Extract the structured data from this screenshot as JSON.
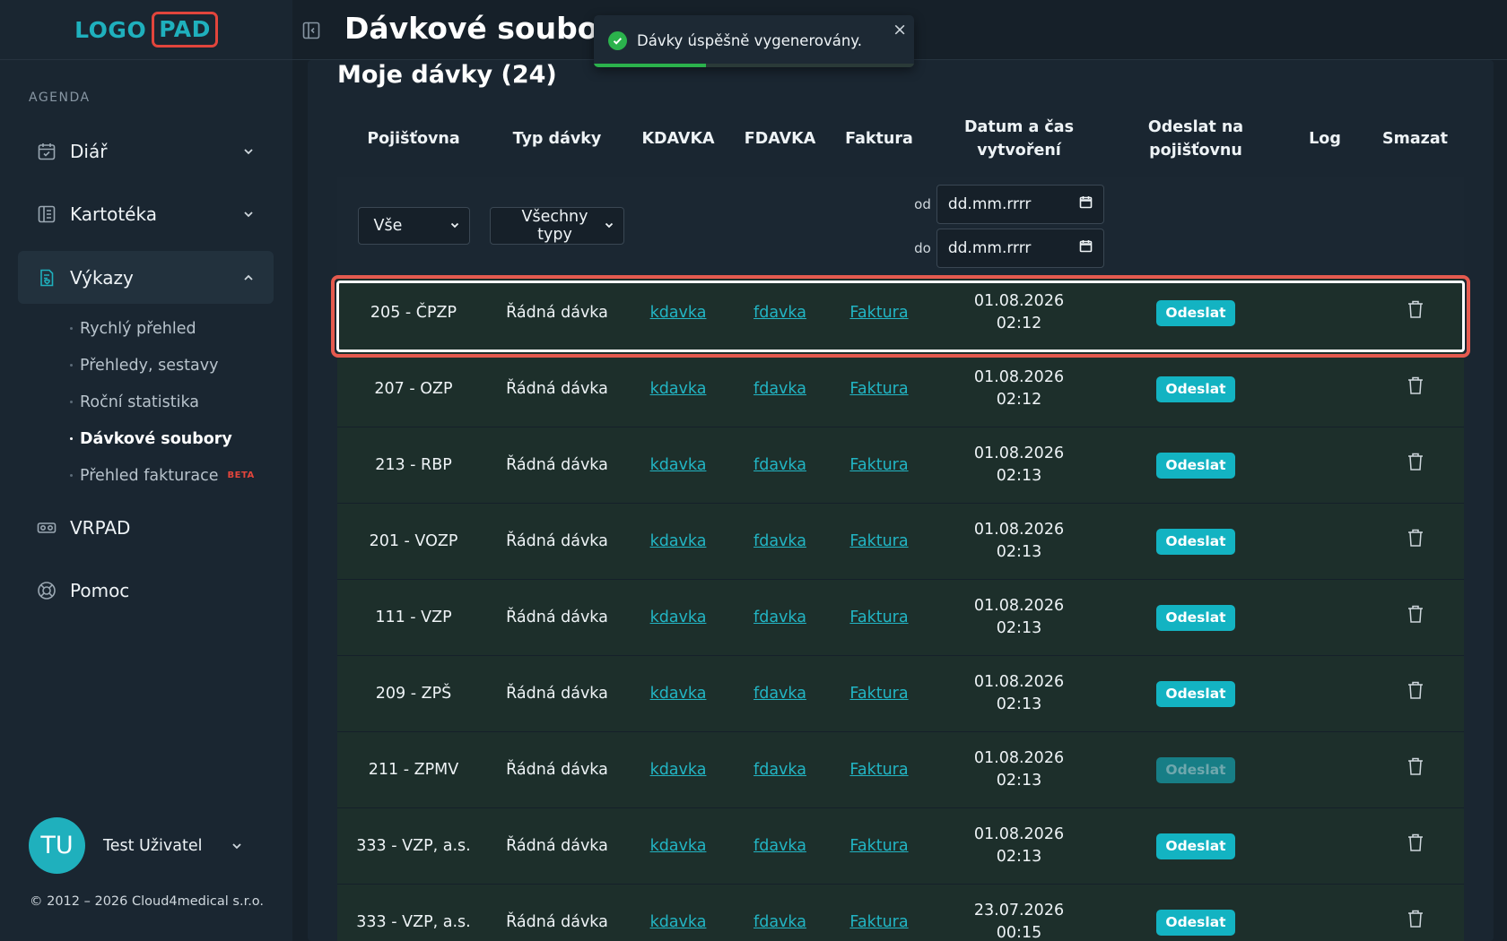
{
  "app": {
    "logo_left": "LOGO",
    "logo_right": "PAD",
    "page_title": "Dávkové soubory"
  },
  "sidebar": {
    "section_label": "AGENDA",
    "items": [
      {
        "label": "Diář",
        "icon": "calendar-icon"
      },
      {
        "label": "Kartotéka",
        "icon": "card-index-icon"
      },
      {
        "label": "Výkazy",
        "icon": "report-icon",
        "expanded": true
      },
      {
        "label": "VRPAD",
        "icon": "vr-glasses-icon"
      },
      {
        "label": "Pomoc",
        "icon": "lifebuoy-icon"
      }
    ],
    "sub_items": [
      {
        "label": "Rychlý přehled"
      },
      {
        "label": "Přehledy, sestavy"
      },
      {
        "label": "Roční statistika"
      },
      {
        "label": "Dávkové soubory",
        "active": true
      },
      {
        "label": "Přehled fakturace",
        "badge": "BETA"
      }
    ],
    "user": {
      "initials": "TU",
      "name": "Test Uživatel"
    },
    "copyright": "© 2012 – 2026 Cloud4medical s.r.o."
  },
  "toast": {
    "message": "Dávky úspěšně vygenerovány.",
    "close": "×",
    "progress": 0.35
  },
  "main": {
    "section_title": "Moje dávky (24)",
    "columns": [
      "Pojišťovna",
      "Typ dávky",
      "KDAVKA",
      "FDAVKA",
      "Faktura",
      "Datum a čas vytvoření",
      "Odeslat na pojišťovnu",
      "Log",
      "Smazat"
    ],
    "filters": {
      "insurer": "Vše",
      "type": "Všechny typy",
      "from_label": "od",
      "to_label": "do",
      "from_placeholder": "dd.mm.rrrr",
      "to_placeholder": "dd.mm.rrrr"
    },
    "rows": [
      {
        "insurer": "205 - ČPZP",
        "type": "Řádná dávka",
        "kdavka": "kdavka",
        "fdavka": "fdavka",
        "faktura": "Faktura",
        "date": "01.08.2026",
        "time": "02:12",
        "send": "Odeslat",
        "send_enabled": true
      },
      {
        "insurer": "207 - OZP",
        "type": "Řádná dávka",
        "kdavka": "kdavka",
        "fdavka": "fdavka",
        "faktura": "Faktura",
        "date": "01.08.2026",
        "time": "02:12",
        "send": "Odeslat",
        "send_enabled": true
      },
      {
        "insurer": "213 - RBP",
        "type": "Řádná dávka",
        "kdavka": "kdavka",
        "fdavka": "fdavka",
        "faktura": "Faktura",
        "date": "01.08.2026",
        "time": "02:13",
        "send": "Odeslat",
        "send_enabled": true
      },
      {
        "insurer": "201 - VOZP",
        "type": "Řádná dávka",
        "kdavka": "kdavka",
        "fdavka": "fdavka",
        "faktura": "Faktura",
        "date": "01.08.2026",
        "time": "02:13",
        "send": "Odeslat",
        "send_enabled": true
      },
      {
        "insurer": "111 - VZP",
        "type": "Řádná dávka",
        "kdavka": "kdavka",
        "fdavka": "fdavka",
        "faktura": "Faktura",
        "date": "01.08.2026",
        "time": "02:13",
        "send": "Odeslat",
        "send_enabled": true
      },
      {
        "insurer": "209 - ZPŠ",
        "type": "Řádná dávka",
        "kdavka": "kdavka",
        "fdavka": "fdavka",
        "faktura": "Faktura",
        "date": "01.08.2026",
        "time": "02:13",
        "send": "Odeslat",
        "send_enabled": true
      },
      {
        "insurer": "211 - ZPMV",
        "type": "Řádná dávka",
        "kdavka": "kdavka",
        "fdavka": "fdavka",
        "faktura": "Faktura",
        "date": "01.08.2026",
        "time": "02:13",
        "send": "Odeslat",
        "send_enabled": false
      },
      {
        "insurer": "333 - VZP, a.s.",
        "type": "Řádná dávka",
        "kdavka": "kdavka",
        "fdavka": "fdavka",
        "faktura": "Faktura",
        "date": "01.08.2026",
        "time": "02:13",
        "send": "Odeslat",
        "send_enabled": true
      },
      {
        "insurer": "333 - VZP, a.s.",
        "type": "Řádná dávka",
        "kdavka": "kdavka",
        "fdavka": "fdavka",
        "faktura": "Faktura",
        "date": "23.07.2026",
        "time": "00:15",
        "send": "Odeslat",
        "send_enabled": true
      }
    ]
  },
  "colors": {
    "accent": "#1fb0bd",
    "highlight": "#e55a4f",
    "success": "#2bb24c",
    "beta": "#e2453c"
  }
}
